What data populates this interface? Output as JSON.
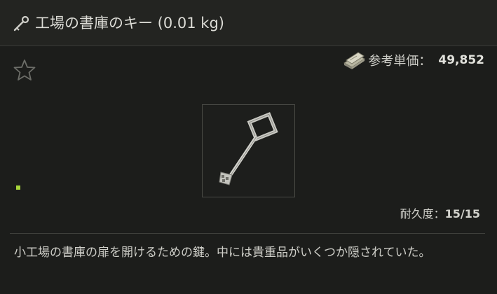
{
  "title": {
    "icon": "key-icon",
    "text": "工場の書庫のキー (0.01 kg)"
  },
  "favorite": {
    "icon": "star-outline-icon"
  },
  "price": {
    "icon": "money-stack-icon",
    "label": "参考単価：",
    "value": "49,852"
  },
  "item": {
    "image": "key-image"
  },
  "status": {
    "indicator_color": "#a8d63a"
  },
  "durability": {
    "label": "耐久度：",
    "value": "15/15"
  },
  "description": "小工場の書庫の扉を開けるための鍵。中には貴重品がいくつか隠されていた。",
  "colors": {
    "background": "#1c1d1b",
    "title_bar": "#232421",
    "text": "#d9d9d3",
    "accent_green": "#a8d63a"
  }
}
